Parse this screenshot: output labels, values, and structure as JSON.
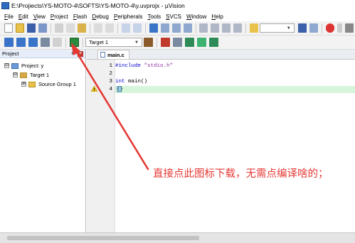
{
  "window": {
    "title": "E:\\Projiects\\YS-MOTO-4\\SOFTS\\YS-MOTO-4\\y.uvprojx - µVision"
  },
  "menu": [
    {
      "label": "File",
      "u": "F",
      "rest": "ile"
    },
    {
      "label": "Edit",
      "u": "E",
      "rest": "dit"
    },
    {
      "label": "View",
      "u": "V",
      "rest": "iew"
    },
    {
      "label": "Project",
      "u": "P",
      "rest": "roject"
    },
    {
      "label": "Flash",
      "u": "F",
      "rest": "lash"
    },
    {
      "label": "Debug",
      "u": "D",
      "rest": "ebug"
    },
    {
      "label": "Peripherals",
      "u": "P",
      "rest": "eripherals"
    },
    {
      "label": "Tools",
      "u": "T",
      "rest": "ools"
    },
    {
      "label": "SVCS",
      "u": "S",
      "rest": "VCS"
    },
    {
      "label": "Window",
      "u": "W",
      "rest": "indow"
    },
    {
      "label": "Help",
      "u": "H",
      "rest": "elp"
    }
  ],
  "toolbar2": {
    "target_select": "Target 1"
  },
  "project_panel": {
    "title": "Project",
    "root": "Project: y",
    "target": "Target 1",
    "group": "Source Group 1",
    "toggle_minus": "⊟",
    "toggle_plus": "⊞"
  },
  "editor": {
    "tab": "main.c",
    "lines": [
      {
        "n": "1",
        "pre": "#include ",
        "str": "\"stdio.h\"",
        "post": ""
      },
      {
        "n": "2",
        "pre": "",
        "str": "",
        "post": ""
      },
      {
        "n": "3",
        "kw": "int",
        "pre": " main()",
        "str": "",
        "post": ""
      },
      {
        "n": "4",
        "pre": "",
        "str": "",
        "post": "{}"
      }
    ]
  },
  "annotation": {
    "text": "直接点此图标下载，无需点编译啥的；"
  },
  "colors": {
    "annotation": "#e53935",
    "accent": "#2e6cbf",
    "highlight": "#d7f5da"
  }
}
